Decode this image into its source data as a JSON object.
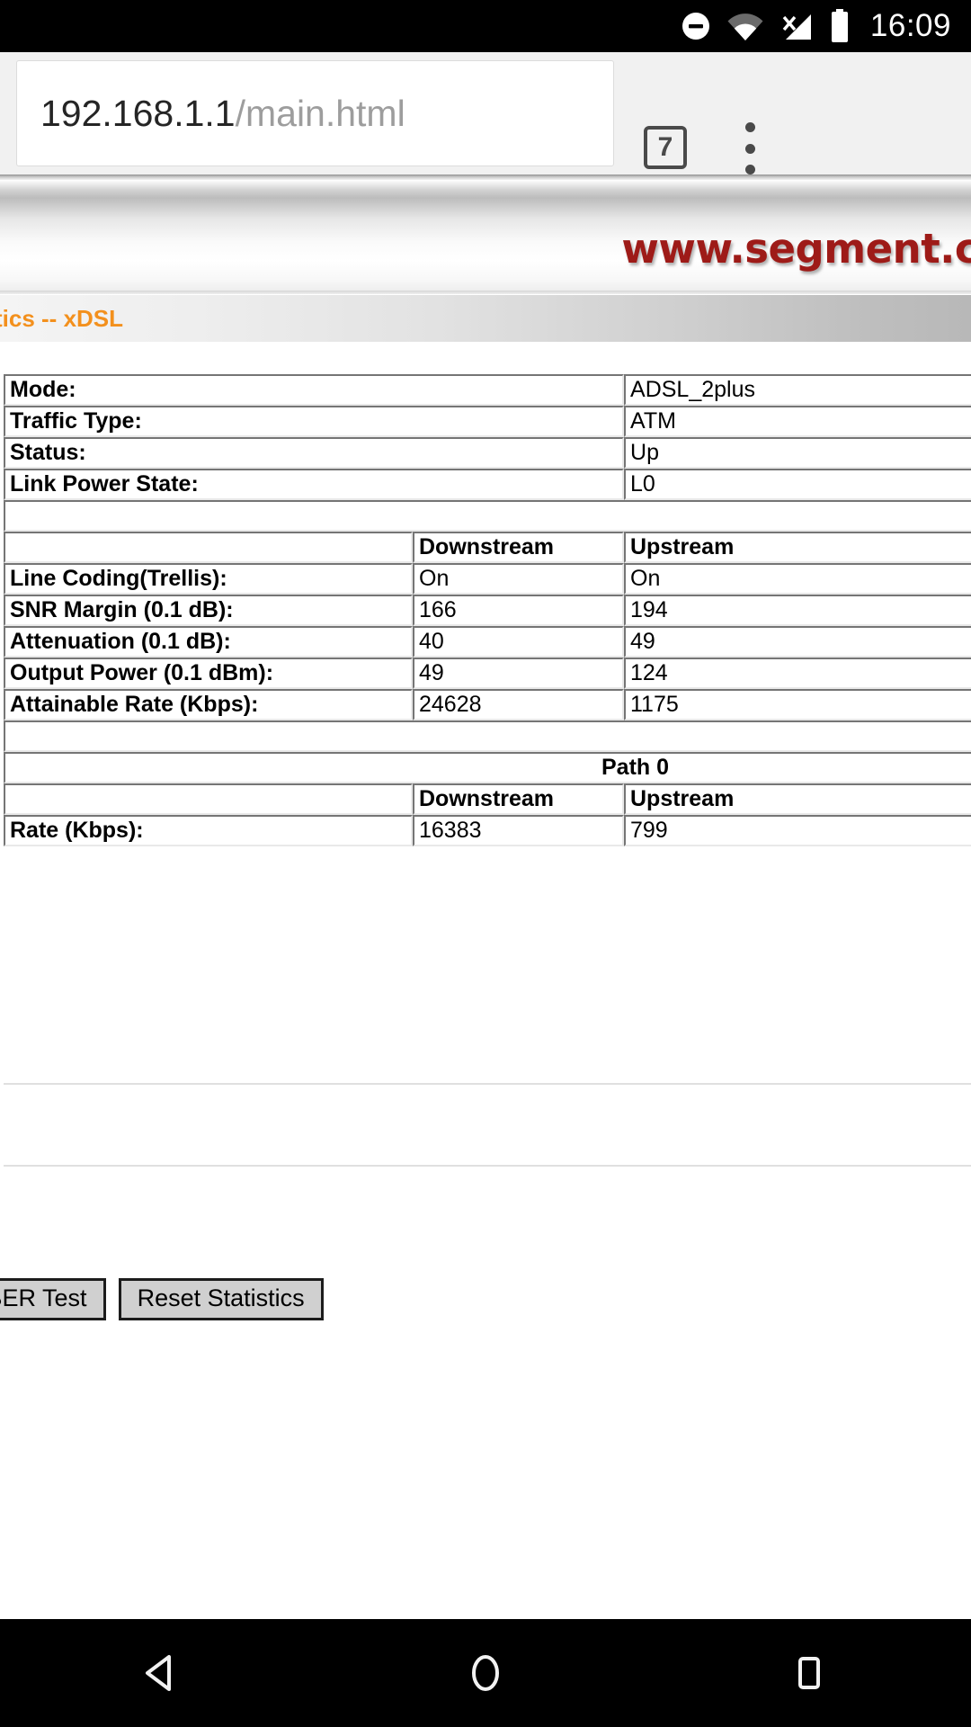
{
  "statusbar": {
    "time": "16:09",
    "icons": [
      "do-not-disturb-icon",
      "wifi-icon",
      "cell-signal-no-sim-icon",
      "battery-full-icon"
    ]
  },
  "browser": {
    "url_host": "192.168.1.1",
    "url_path": "/main.html",
    "url_full": "192.168.1.1/main.html",
    "tab_count": "7",
    "menu_label": "⋮"
  },
  "page": {
    "banner_logo": "www.segment.c",
    "title": "tics -- xDSL",
    "accent_orange": "#f3901d",
    "logo_red": "#9e1b18",
    "label_bg": "#c8c8c8"
  },
  "info_table": {
    "rows": [
      {
        "label": "Mode:",
        "value": "ADSL_2plus"
      },
      {
        "label": "Traffic Type:",
        "value": "ATM"
      },
      {
        "label": "Status:",
        "value": "Up"
      },
      {
        "label": "Link Power State:",
        "value": "L0"
      }
    ]
  },
  "stats_table": {
    "headers": {
      "blank": "",
      "downstream": "Downstream",
      "upstream": "Upstream"
    },
    "rows": [
      {
        "label": "Line Coding(Trellis):",
        "downstream": "On",
        "upstream": "On"
      },
      {
        "label": "SNR Margin (0.1 dB):",
        "downstream": "166",
        "upstream": "194"
      },
      {
        "label": "Attenuation (0.1 dB):",
        "downstream": "40",
        "upstream": "49"
      },
      {
        "label": "Output Power (0.1 dBm):",
        "downstream": "49",
        "upstream": "124"
      },
      {
        "label": "Attainable Rate (Kbps):",
        "downstream": "24628",
        "upstream": "1175"
      }
    ]
  },
  "path_table": {
    "title": "Path 0",
    "headers": {
      "blank": "",
      "downstream": "Downstream",
      "upstream": "Upstream"
    },
    "rows": [
      {
        "label": "Rate (Kbps):",
        "downstream": "16383",
        "upstream": "799"
      }
    ]
  },
  "buttons": {
    "ber_test": "L BER Test",
    "reset_statistics": "Reset Statistics"
  },
  "navbar": {
    "back": "back-button",
    "home": "home-button",
    "recents": "recents-button"
  }
}
